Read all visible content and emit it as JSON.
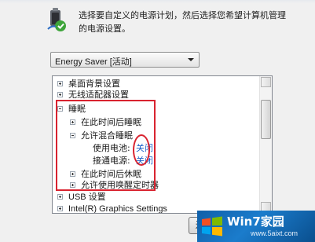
{
  "description_text": "选择要自定义的电源计划，然后选择您希望计算机管理的电源设置。",
  "plan_select": {
    "selected": "Energy Saver [活动]"
  },
  "tree_items": [
    {
      "label": "桌面背景设置",
      "state": "plus"
    },
    {
      "label": "无线适配器设置",
      "state": "plus"
    },
    {
      "label": "睡眠",
      "state": "minus"
    },
    {
      "label": "在此时间后睡眠",
      "state": "plus"
    },
    {
      "label": "允许混合睡眠",
      "state": "minus"
    },
    {
      "label": "使用电池:",
      "value": "关闭"
    },
    {
      "label": "接通电源:",
      "value": "关闭"
    },
    {
      "label": "在此时间后休眠",
      "state": "plus"
    },
    {
      "label": "允许使用唤醒定时器",
      "state": "plus"
    },
    {
      "label": "USB 设置",
      "state": "plus"
    },
    {
      "label": "Intel(R) Graphics Settings",
      "state": "plus"
    }
  ],
  "bottom_button": {
    "label": "还"
  },
  "watermark": {
    "brand": "Win7家园",
    "site": "www.5aixt.com"
  },
  "colors": {
    "highlight": "#d9232f",
    "value_link": "#1a5fc8",
    "logo_bg": "#0f5fa8"
  },
  "icons": {
    "power_plan": "battery-plug-icon",
    "dropdown": "chevron-down-icon",
    "logo": "windows-flag-icon"
  }
}
